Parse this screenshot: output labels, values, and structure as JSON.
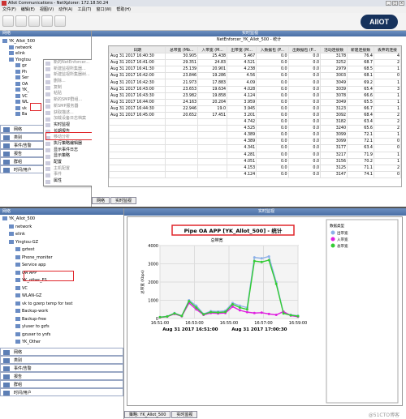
{
  "window": {
    "title": "Allot Communications - NetXplorer: 172.18.50.24",
    "brand": "AllOT"
  },
  "menubar": [
    "文件(F)",
    "编辑(E)",
    "视图(V)",
    "动作(A)",
    "工具(T)",
    "窗口(W)",
    "帮助(H)"
  ],
  "top": {
    "left_header": "网络",
    "tree": [
      {
        "label": "YK_Allot_500",
        "indent": 0
      },
      {
        "label": "network",
        "indent": 1
      },
      {
        "label": "elink",
        "indent": 1
      },
      {
        "label": "Yingtou",
        "indent": 1
      },
      {
        "label": "gz",
        "indent": 2
      },
      {
        "label": "Ph",
        "indent": 2
      },
      {
        "label": "Ser",
        "indent": 2
      },
      {
        "label": "OA",
        "indent": 2
      },
      {
        "label": "YK_",
        "indent": 2
      },
      {
        "label": "VC",
        "indent": 2
      },
      {
        "label": "WL",
        "indent": 2
      },
      {
        "label": "vk",
        "indent": 2
      },
      {
        "label": "Ba",
        "indent": 2
      }
    ],
    "context_menu1": [
      {
        "label": "新的NetEnforcer...",
        "dis": true
      },
      {
        "label": "新建监视所集器...",
        "dis": true
      },
      {
        "label": "新建监视所集器树...",
        "dis": true
      },
      {
        "label": "删除...",
        "dis": true
      },
      {
        "label": "复制",
        "dis": true
      },
      {
        "label": "粘贴",
        "dis": true
      },
      {
        "label": "新的SMP群组...",
        "dis": true
      },
      {
        "label": "新SMP服务器",
        "dis": true
      },
      {
        "label": "获取描述...",
        "dis": true
      },
      {
        "label": "加载设备日志档案",
        "dis": true
      },
      {
        "label": "实时监视",
        "dis": false
      },
      {
        "label": "长期报告",
        "dis": false
      },
      {
        "label": "移动分析",
        "dis": true
      },
      {
        "label": "执行策略编辑器",
        "dis": false
      },
      {
        "label": "显示事件日志",
        "dis": false
      },
      {
        "label": "显示策略",
        "dis": false
      },
      {
        "label": "配置",
        "dis": false
      },
      {
        "label": "主机配置",
        "dis": true
      },
      {
        "label": "事件",
        "dis": true
      },
      {
        "label": "属性",
        "dis": false
      }
    ],
    "context_menu2": [
      "统计",
      "利用率...",
      "Virtual Channels...",
      "协议...",
      "主机...",
      "内部主机...",
      "外部主机...",
      "Monitoring.MonLabels.AUTOSYSTEM_NEXT_HOP_ISSUE_LBL!",
      "Monitoring.MonLabels.AUTOSYSTEM_DESTINATION_ISSUE_LBL!"
    ],
    "nav": [
      "网络",
      "类别",
      "事件/告警",
      "报告",
      "群组",
      "时间/用户"
    ],
    "right_header": "实时监视",
    "table_title": "NetEnforcer_YK_Allot_500 - 统计",
    "columns": [
      "日期",
      "总带宽 (Mb...",
      "入带宽 (M...",
      "出带宽 (M...",
      "入数据包 (P...",
      "出数据包 (P...",
      "活动连接数",
      "新建连接数",
      "丢弃的连接"
    ],
    "rows": [
      [
        "Aug 31 2017 16:40:30",
        "30.905",
        "25.438",
        "5.467",
        "0.0",
        "0.0",
        "3178",
        "76.4",
        "4"
      ],
      [
        "Aug 31 2017 16:41:00",
        "29.351",
        "24.83",
        "4.521",
        "0.0",
        "0.0",
        "3252",
        "68.7",
        "2"
      ],
      [
        "Aug 31 2017 16:41:30",
        "25.139",
        "20.901",
        "4.238",
        "0.0",
        "0.0",
        "2979",
        "68.5",
        "1"
      ],
      [
        "Aug 31 2017 16:42:00",
        "23.846",
        "19.286",
        "4.56",
        "0.0",
        "0.0",
        "3003",
        "68.1",
        "0"
      ],
      [
        "Aug 31 2017 16:42:30",
        "21.973",
        "17.883",
        "4.09",
        "0.0",
        "0.0",
        "3049",
        "69.2",
        "1"
      ],
      [
        "Aug 31 2017 16:43:00",
        "23.653",
        "19.634",
        "4.028",
        "0.0",
        "0.0",
        "3039",
        "65.4",
        "3"
      ],
      [
        "Aug 31 2017 16:43:30",
        "23.982",
        "19.858",
        "4.124",
        "0.0",
        "0.0",
        "3078",
        "66.6",
        "1"
      ],
      [
        "Aug 31 2017 16:44:00",
        "24.163",
        "20.204",
        "3.959",
        "0.0",
        "0.0",
        "3049",
        "65.5",
        "1"
      ],
      [
        "Aug 31 2017 16:44:30",
        "22.946",
        "19.0",
        "3.945",
        "0.0",
        "0.0",
        "3123",
        "66.7",
        "1"
      ],
      [
        "Aug 31 2017 16:45:00",
        "20.652",
        "17.451",
        "3.201",
        "0.0",
        "0.0",
        "3092",
        "68.4",
        "2"
      ],
      [
        "",
        "",
        "",
        "4.742",
        "0.0",
        "0.0",
        "3182",
        "63.4",
        "2"
      ],
      [
        "",
        "",
        "",
        "4.525",
        "0.0",
        "0.0",
        "3240",
        "65.6",
        "2"
      ],
      [
        "",
        "",
        "",
        "4.389",
        "0.0",
        "0.0",
        "3099",
        "72.1",
        "1"
      ],
      [
        "",
        "",
        "",
        "4.389",
        "0.0",
        "0.0",
        "3099",
        "72.1",
        "0"
      ],
      [
        "",
        "",
        "",
        "4.341",
        "0.0",
        "0.0",
        "3177",
        "63.4",
        "0"
      ],
      [
        "",
        "",
        "",
        "4.281",
        "0.0",
        "0.0",
        "3217",
        "71.9",
        "1"
      ],
      [
        "",
        "",
        "",
        "4.051",
        "0.0",
        "0.0",
        "3156",
        "70.2",
        "1"
      ],
      [
        "",
        "",
        "",
        "4.153",
        "0.0",
        "0.0",
        "3125",
        "71.1",
        "2"
      ],
      [
        "",
        "",
        "",
        "4.124",
        "0.0",
        "0.0",
        "3147",
        "74.1",
        "0"
      ]
    ],
    "tabs": [
      "网络",
      "实时监视"
    ]
  },
  "bottom": {
    "left_header": "网络",
    "tree": [
      {
        "label": "YK_Allot_500",
        "indent": 0
      },
      {
        "label": "network",
        "indent": 1
      },
      {
        "label": "elink",
        "indent": 1
      },
      {
        "label": "Yingtou-GZ",
        "indent": 1
      },
      {
        "label": "gztest",
        "indent": 2
      },
      {
        "label": "Phone_moniter",
        "indent": 2
      },
      {
        "label": "Service app",
        "indent": 2
      },
      {
        "label": "OA APP",
        "indent": 2
      },
      {
        "label": "YK_other_FS",
        "indent": 2
      },
      {
        "label": "VC",
        "indent": 2
      },
      {
        "label": "WLAN-GZ",
        "indent": 2
      },
      {
        "label": "vk to gzerp temp for test",
        "indent": 2
      },
      {
        "label": "Backup-work",
        "indent": 2
      },
      {
        "label": "Backup-free",
        "indent": 2
      },
      {
        "label": "yluser to gzfs",
        "indent": 2
      },
      {
        "label": "gzuser to ynfs",
        "indent": 2
      },
      {
        "label": "YK_Other",
        "indent": 2
      }
    ],
    "nav": [
      "网络",
      "类别",
      "事件/告警",
      "报告",
      "群组",
      "时间/用户"
    ],
    "right_header": "实时监视",
    "chart_title": "Pipe OA APP [YK_Allot_500] - 统计",
    "tabs": [
      "策略: YK_Allot_500",
      "实时监视"
    ],
    "watermark": "@51CTO博客"
  },
  "chart_data": {
    "type": "line",
    "subtitle": "总带宽",
    "ylabel": "总带宽 (Kbps)",
    "ylim": [
      0,
      4000
    ],
    "yticks": [
      0,
      1000,
      2000,
      3000,
      4000
    ],
    "xticks": [
      "16:51:00",
      "16:53:00",
      "16:55:00",
      "16:57:00",
      "16:59:00"
    ],
    "xrange_labels": [
      "Aug 31 2017 16:51:00",
      "Aug 31 2017 17:00:30"
    ],
    "legend_title": "数据类型",
    "x": [
      0,
      0.5,
      1,
      1.5,
      2,
      2.5,
      3,
      3.5,
      4,
      4.5,
      5,
      5.5,
      6,
      6.5,
      7,
      7.5,
      8,
      8.5,
      9,
      9.5
    ],
    "series": [
      {
        "name": "出带宽",
        "color": "#8db0e8",
        "values": [
          80,
          120,
          300,
          150,
          1000,
          700,
          250,
          400,
          380,
          420,
          850,
          700,
          600,
          3350,
          3300,
          3400,
          2000,
          300,
          200,
          150
        ]
      },
      {
        "name": "入带宽",
        "color": "#e020e0",
        "values": [
          60,
          100,
          250,
          120,
          850,
          500,
          200,
          300,
          280,
          300,
          650,
          450,
          350,
          300,
          320,
          250,
          200,
          380,
          160,
          100
        ]
      },
      {
        "name": "总带宽",
        "color": "#33cc33",
        "values": [
          70,
          110,
          280,
          140,
          950,
          600,
          230,
          350,
          330,
          360,
          780,
          600,
          500,
          3150,
          3100,
          3200,
          1900,
          280,
          180,
          130
        ]
      }
    ]
  }
}
